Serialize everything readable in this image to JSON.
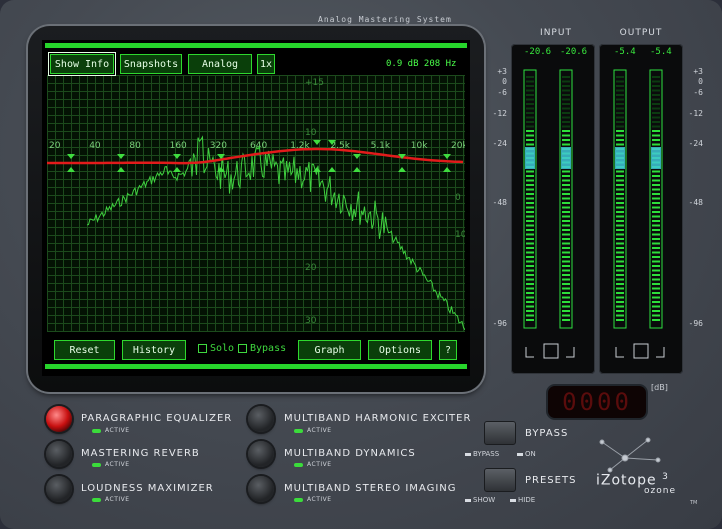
{
  "header": {
    "subtitle": "Analog Mastering System"
  },
  "graph": {
    "buttons": {
      "show_info": "Show Info",
      "snapshots": "Snapshots",
      "analog": "Analog",
      "zoom": "1x"
    },
    "readout": "0.9 dB 208 Hz",
    "freq_labels": [
      "20",
      "40",
      "80",
      "160",
      "320",
      "640",
      "1.2k",
      "2.5k",
      "5.1k",
      "10k",
      "20k"
    ],
    "db_labels": [
      "+15",
      "10",
      "0",
      "10",
      "20",
      "30"
    ],
    "bottom": {
      "reset": "Reset",
      "history": "History",
      "solo": "Solo",
      "bypass": "Bypass",
      "graph": "Graph",
      "options": "Options",
      "help": "?"
    }
  },
  "meters": {
    "input": {
      "title": "INPUT",
      "left": "-20.6",
      "right": "-20.6"
    },
    "output": {
      "title": "OUTPUT",
      "left": "-5.4",
      "right": "-5.4"
    },
    "scale": [
      "+3",
      "0",
      "-6",
      "-12",
      "-24",
      "-48",
      "-96"
    ],
    "db_unit": "[dB]",
    "led_readout": "0000"
  },
  "modules": [
    {
      "name": "PARAGRAPHIC EQUALIZER",
      "status": "ACTIVE",
      "on": true
    },
    {
      "name": "MASTERING REVERB",
      "status": "ACTIVE",
      "on": false
    },
    {
      "name": "LOUDNESS MAXIMIZER",
      "status": "ACTIVE",
      "on": false
    },
    {
      "name": "MULTIBAND HARMONIC EXCITER",
      "status": "ACTIVE",
      "on": false
    },
    {
      "name": "MULTIBAND DYNAMICS",
      "status": "ACTIVE",
      "on": false
    },
    {
      "name": "MULTIBAND STEREO IMAGING",
      "status": "ACTIVE",
      "on": false
    }
  ],
  "bypass": {
    "label": "BYPASS",
    "opt_a": "BYPASS",
    "opt_b": "ON"
  },
  "presets": {
    "label": "PRESETS",
    "opt_a": "SHOW",
    "opt_b": "HIDE"
  },
  "brand": {
    "name": "iZotope",
    "product": "ozone",
    "version": "3",
    "tm": "TM"
  },
  "colors": {
    "accent": "#2ed82e",
    "eq_curve": "#e21b1b",
    "spectrum": "#3fcf3f"
  }
}
